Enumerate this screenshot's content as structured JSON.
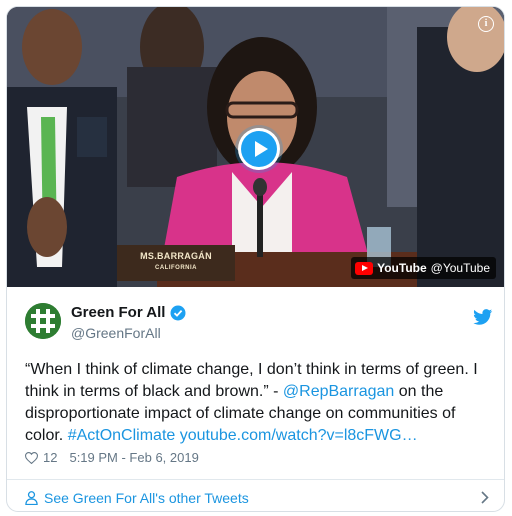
{
  "media": {
    "nameplate_line1": "MS.BARRAGÁN",
    "nameplate_line2": "CALIFORNIA",
    "youtube_badge_brand": "YouTube",
    "youtube_badge_channel": "@YouTube",
    "info_icon_label": "i"
  },
  "author": {
    "name": "Green For All",
    "handle": "@GreenForAll"
  },
  "tweet": {
    "text_part1": "“When I think of climate change, I don’t think in terms of green. I think in terms of black and brown.” - ",
    "mention": "@RepBarragan",
    "text_part2": " on the disproportionate impact of climate change on communities of color. ",
    "hashtag": "#ActOnClimate",
    "space": " ",
    "url": "youtube.com/watch?v=l8cFWG…"
  },
  "meta": {
    "likes": "12",
    "timestamp": "5:19 PM - Feb 6, 2019"
  },
  "footer": {
    "see_more": "See Green For All's other Tweets"
  },
  "colors": {
    "link": "#1b95e0",
    "verified": "#1da1f2",
    "play_button": "#1da1f2",
    "avatar": "#2e7d32"
  },
  "icons": [
    "info-icon",
    "play-icon",
    "youtube-icon",
    "verified-badge-icon",
    "twitter-bird-icon",
    "heart-icon",
    "person-icon",
    "chevron-right-icon"
  ]
}
